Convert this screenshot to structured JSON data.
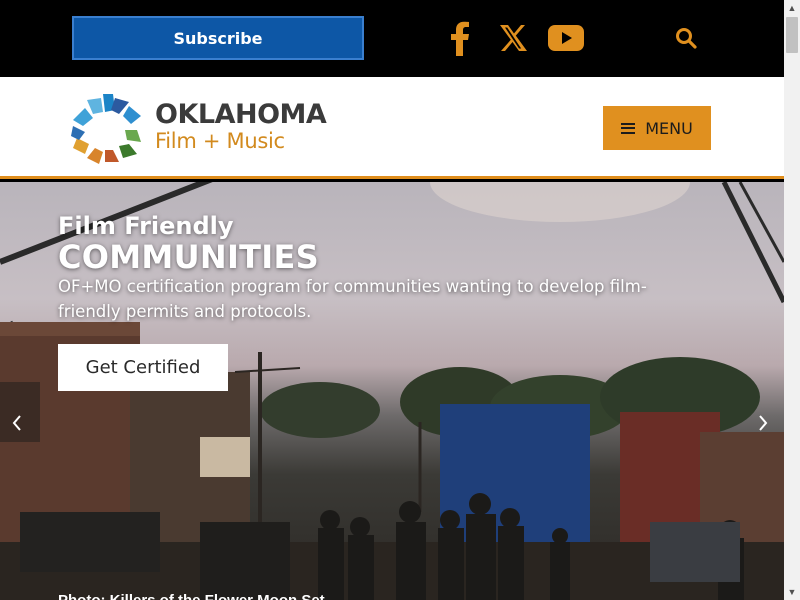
{
  "topbar": {
    "subscribe_label": "Subscribe",
    "social": [
      "facebook-icon",
      "x-icon",
      "youtube-icon"
    ],
    "search_icon": "search-icon",
    "accent": "#e0901f",
    "subscribe_color": "#0d57a6"
  },
  "header": {
    "logo_line1": "OKLAHOMA",
    "logo_line2": "Film + Music",
    "menu_label": "MENU",
    "border_color": "#e08e1c"
  },
  "hero": {
    "title_line1": "Film Friendly",
    "title_line2": "COMMUNITIES",
    "description": "OF+MO certification program for communities wanting to develop film-friendly permits and protocols.",
    "cta_label": "Get Certified",
    "prev_icon": "chevron-left-icon",
    "next_icon": "chevron-right-icon",
    "caption": "Photo: Killers of the Flower Moon Set"
  }
}
